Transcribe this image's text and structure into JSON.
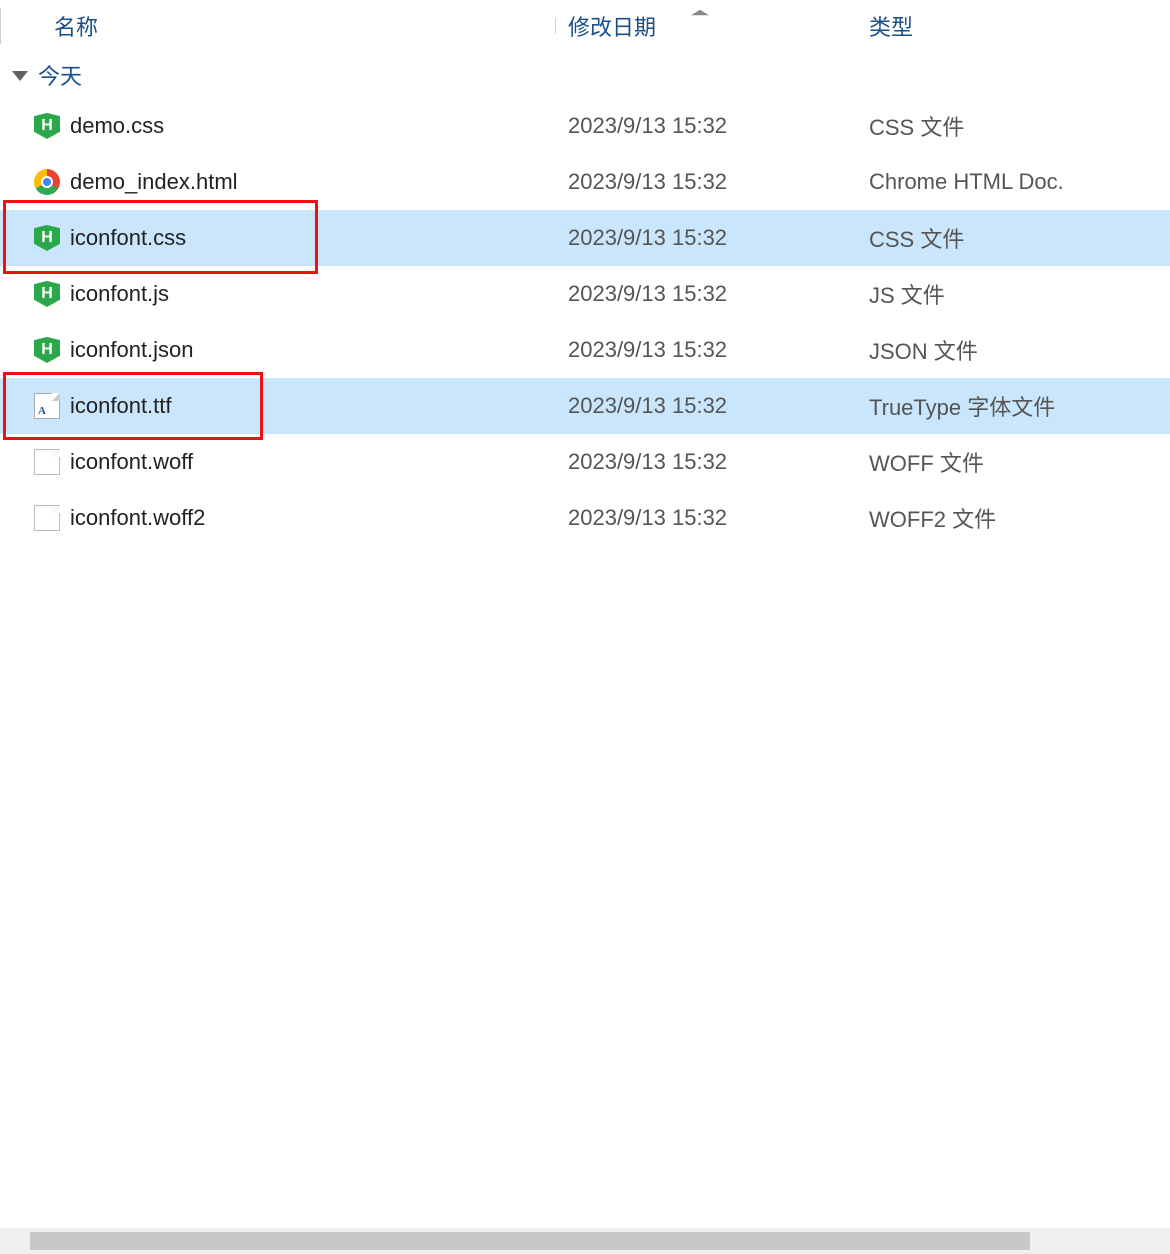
{
  "columns": {
    "name": "名称",
    "date": "修改日期",
    "type": "类型"
  },
  "group": {
    "label": "今天"
  },
  "files": [
    {
      "icon": "hbuilder",
      "name": "demo.css",
      "date": "2023/9/13 15:32",
      "type": "CSS 文件",
      "selected": false
    },
    {
      "icon": "chrome",
      "name": "demo_index.html",
      "date": "2023/9/13 15:32",
      "type": "Chrome HTML Doc.",
      "selected": false
    },
    {
      "icon": "hbuilder",
      "name": "iconfont.css",
      "date": "2023/9/13 15:32",
      "type": "CSS 文件",
      "selected": true
    },
    {
      "icon": "hbuilder",
      "name": "iconfont.js",
      "date": "2023/9/13 15:32",
      "type": "JS 文件",
      "selected": false
    },
    {
      "icon": "hbuilder",
      "name": "iconfont.json",
      "date": "2023/9/13 15:32",
      "type": "JSON 文件",
      "selected": false
    },
    {
      "icon": "ttf",
      "name": "iconfont.ttf",
      "date": "2023/9/13 15:32",
      "type": "TrueType 字体文件",
      "selected": true
    },
    {
      "icon": "blank",
      "name": "iconfont.woff",
      "date": "2023/9/13 15:32",
      "type": "WOFF 文件",
      "selected": false
    },
    {
      "icon": "blank",
      "name": "iconfont.woff2",
      "date": "2023/9/13 15:32",
      "type": "WOFF2 文件",
      "selected": false
    }
  ]
}
